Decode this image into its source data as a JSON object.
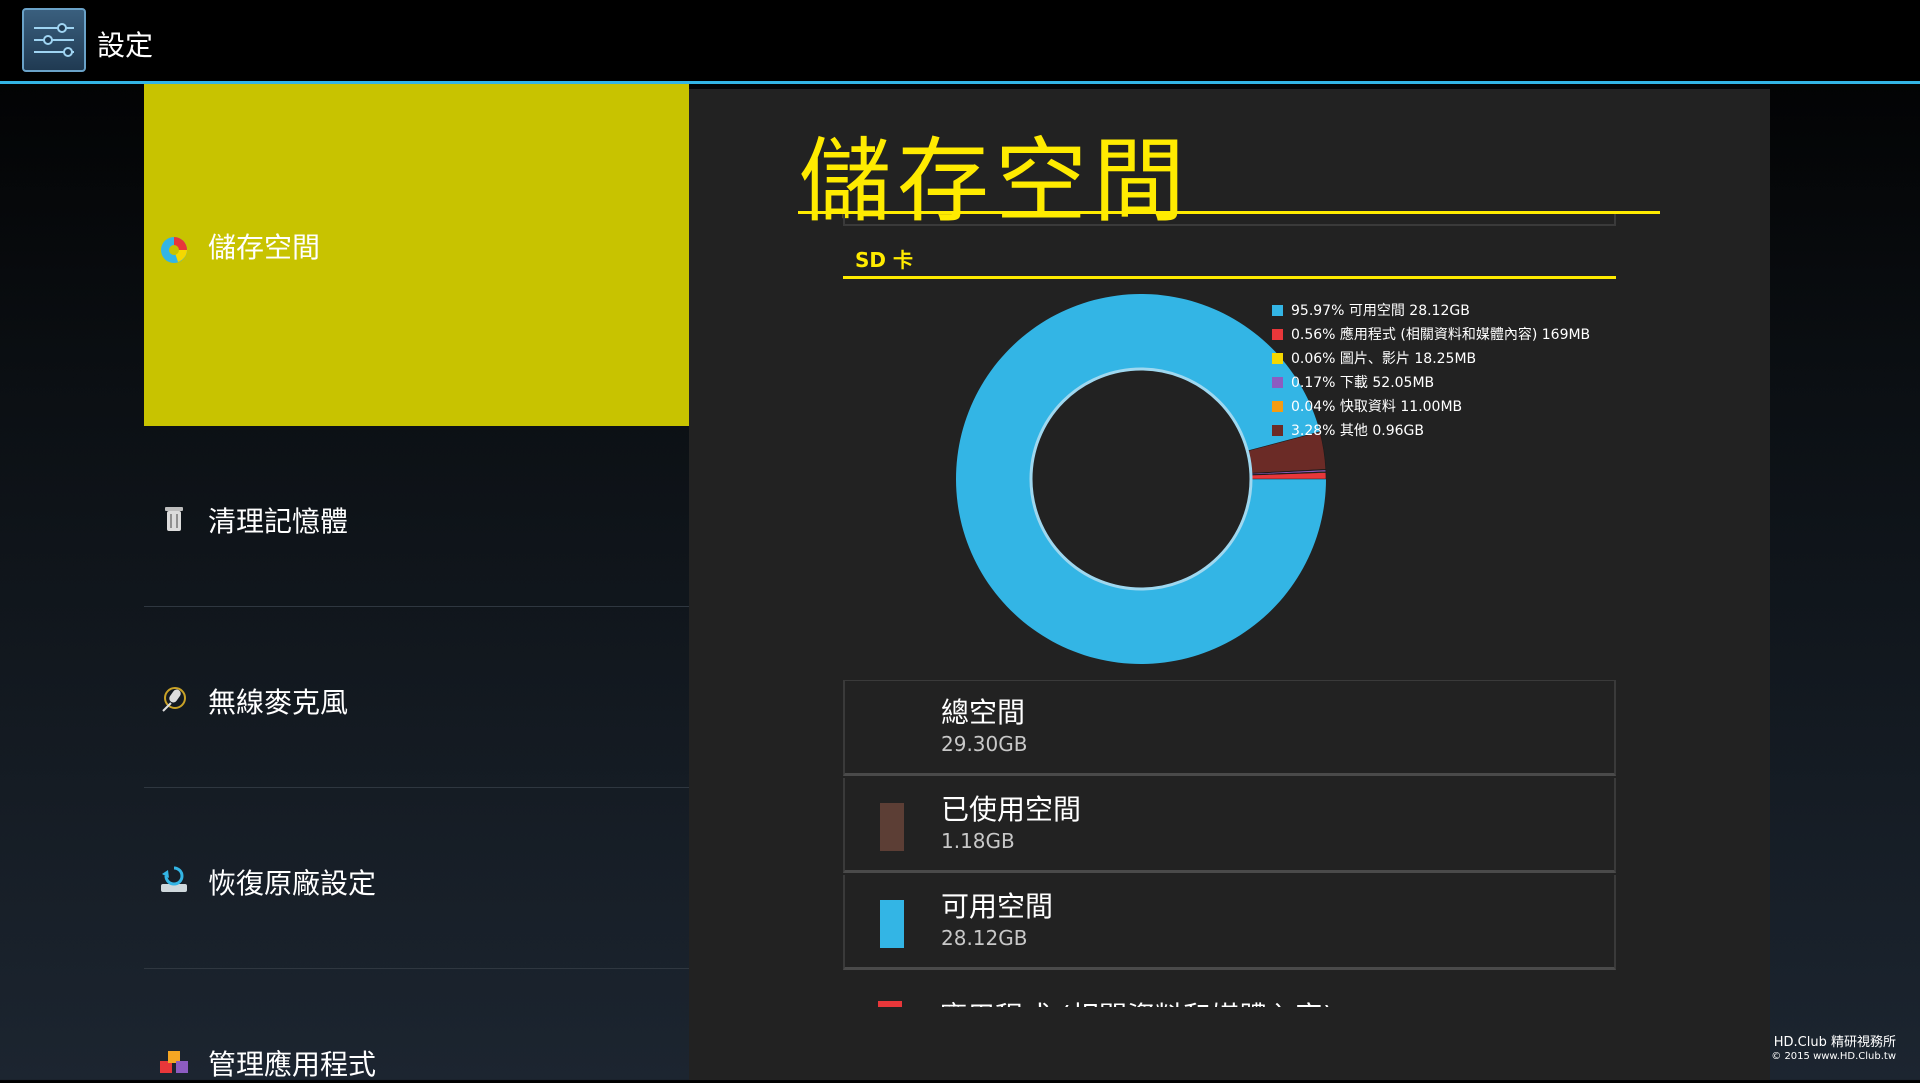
{
  "app": {
    "title": "設定",
    "icon": "settings-sliders-icon"
  },
  "sidebar": {
    "items": [
      {
        "label": "儲存空間",
        "icon": "storage-pie-icon",
        "selected": true
      },
      {
        "label": "清理記憶體",
        "icon": "trash-can-icon",
        "selected": false
      },
      {
        "label": "無線麥克風",
        "icon": "microphone-icon",
        "selected": false
      },
      {
        "label": "恢復原廠設定",
        "icon": "factory-reset-icon",
        "selected": false
      },
      {
        "label": "管理應用程式",
        "icon": "apps-icon",
        "selected": false
      }
    ]
  },
  "main": {
    "title": "儲存空間",
    "section": "SD 卡",
    "legend": [
      {
        "text": "95.97% 可用空間 28.12GB",
        "color": "#33b5e5"
      },
      {
        "text": "0.56% 應用程式 (相關資料和媒體內容) 169MB",
        "color": "#e8373a"
      },
      {
        "text": "0.06% 圖片、影片 18.25MB",
        "color": "#f5d800"
      },
      {
        "text": "0.17% 下載 52.05MB",
        "color": "#8d5cc1"
      },
      {
        "text": "0.04% 快取資料 11.00MB",
        "color": "#f39c12"
      },
      {
        "text": "3.28% 其他 0.96GB",
        "color": "#6b2b26"
      }
    ],
    "stats": [
      {
        "name": "總空間",
        "value": "29.30GB",
        "color": ""
      },
      {
        "name": "已使用空間",
        "value": "1.18GB",
        "color": "#5c3e35"
      },
      {
        "name": "可用空間",
        "value": "28.12GB",
        "color": "#33b5e5"
      }
    ],
    "partial_row": {
      "name": "應用程式 (相關資料和媒體內容)",
      "color": "#e8373a"
    }
  },
  "chart_data": {
    "type": "pie",
    "donut": true,
    "categories": [
      "可用空間",
      "應用程式 (相關資料和媒體內容)",
      "圖片、影片",
      "下載",
      "快取資料",
      "其他"
    ],
    "values": [
      95.97,
      0.56,
      0.06,
      0.17,
      0.04,
      3.28
    ],
    "colors": [
      "#33b5e5",
      "#e8373a",
      "#f5d800",
      "#8d5cc1",
      "#f39c12",
      "#6b2b26"
    ],
    "legend_position": "top-right"
  },
  "watermark": {
    "line1": "HD.Club 精研視務所",
    "line2": "© 2015  www.HD.Club.tw"
  }
}
